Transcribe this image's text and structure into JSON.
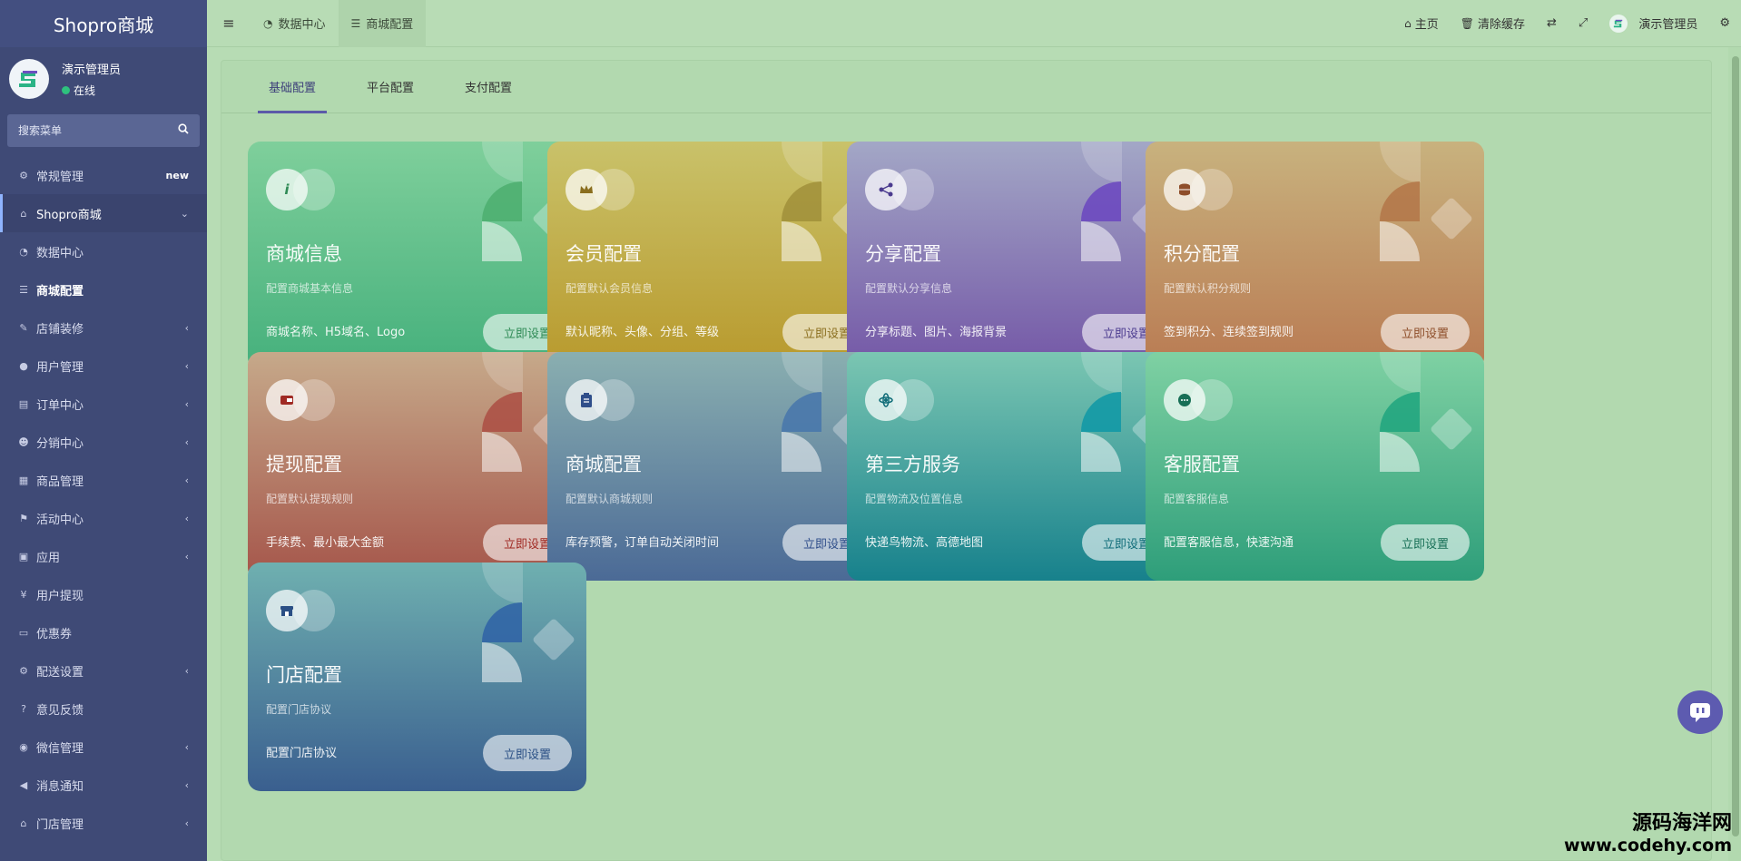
{
  "sidebar": {
    "brand": "Shopro商城",
    "user": {
      "name": "演示管理员",
      "status": "在线"
    },
    "search_placeholder": "搜索菜单",
    "items": [
      {
        "label": "常规管理",
        "icon": "cogs-icon",
        "badge": "new"
      },
      {
        "label": "Shopro商城",
        "icon": "home-icon",
        "arrow": "⌄"
      },
      {
        "label": "数据中心",
        "icon": "dashboard-icon"
      },
      {
        "label": "商城配置",
        "icon": "sliders-icon"
      },
      {
        "label": "店铺装修",
        "icon": "brush-icon",
        "arrow": "‹"
      },
      {
        "label": "用户管理",
        "icon": "user-icon",
        "arrow": "‹"
      },
      {
        "label": "订单中心",
        "icon": "file-icon",
        "arrow": "‹"
      },
      {
        "label": "分销中心",
        "icon": "users-icon",
        "arrow": "‹"
      },
      {
        "label": "商品管理",
        "icon": "list-icon",
        "arrow": "‹"
      },
      {
        "label": "活动中心",
        "icon": "flag-icon",
        "arrow": "‹"
      },
      {
        "label": "应用",
        "icon": "briefcase-icon",
        "arrow": "‹"
      },
      {
        "label": "用户提现",
        "icon": "yen-icon"
      },
      {
        "label": "优惠券",
        "icon": "ticket-icon"
      },
      {
        "label": "配送设置",
        "icon": "cogs-icon",
        "arrow": "‹"
      },
      {
        "label": "意见反馈",
        "icon": "question-icon"
      },
      {
        "label": "微信管理",
        "icon": "wechat-icon",
        "arrow": "‹"
      },
      {
        "label": "消息通知",
        "icon": "bullhorn-icon",
        "arrow": "‹"
      },
      {
        "label": "门店管理",
        "icon": "bank-icon",
        "arrow": "‹"
      }
    ]
  },
  "topbar": {
    "tabs": [
      {
        "label": "数据中心",
        "icon": "dashboard-icon"
      },
      {
        "label": "商城配置",
        "icon": "sliders-icon"
      }
    ],
    "home": "主页",
    "clear_cache": "清除缓存",
    "admin": "演示管理员"
  },
  "content_tabs": [
    "基础配置",
    "平台配置",
    "支付配置"
  ],
  "cards": [
    {
      "title": "商城信息",
      "desc": "配置商城基本信息",
      "feat": "商城名称、H5域名、Logo",
      "btn": "立即设置",
      "icon": "info-icon",
      "c1": "#7fcf9b",
      "c2": "#45b07c",
      "accent": "#4cae6e",
      "btncolor": "#2e8a55"
    },
    {
      "title": "会员配置",
      "desc": "配置默认会员信息",
      "feat": "默认昵称、头像、分组、等级",
      "btn": "立即设置",
      "icon": "crown-icon",
      "c1": "#c9c26a",
      "c2": "#b8992c",
      "accent": "#a08f3a",
      "btncolor": "#8a6e1e"
    },
    {
      "title": "分享配置",
      "desc": "配置默认分享信息",
      "feat": "分享标题、图片、海报背景",
      "btn": "立即设置",
      "icon": "share-icon",
      "c1": "#a3a7c6",
      "c2": "#7356a6",
      "accent": "#6a45c0",
      "btncolor": "#4a3a8e"
    },
    {
      "title": "积分配置",
      "desc": "配置默认积分规则",
      "feat": "签到积分、连续签到规则",
      "btn": "立即设置",
      "icon": "coins-icon",
      "c1": "#c8b27e",
      "c2": "#b97a52",
      "accent": "#b37648",
      "btncolor": "#8e4e2a"
    },
    {
      "title": "提现配置",
      "desc": "配置默认提现规则",
      "feat": "手续费、最小最大金额",
      "btn": "立即设置",
      "icon": "wallet-icon",
      "c1": "#c6a98a",
      "c2": "#a5554a",
      "accent": "#ac4d43",
      "btncolor": "#a02a24"
    },
    {
      "title": "商城配置",
      "desc": "配置默认商城规则",
      "feat": "库存预警，订单自动关闭时间",
      "btn": "立即设置",
      "icon": "clipboard-icon",
      "c1": "#8aafb0",
      "c2": "#4b6a96",
      "accent": "#4676ab",
      "btncolor": "#2f4e8a"
    },
    {
      "title": "第三方服务",
      "desc": "配置物流及位置信息",
      "feat": "快递鸟物流、高德地图",
      "btn": "立即设置",
      "icon": "atom-icon",
      "c1": "#7bc6b2",
      "c2": "#17818c",
      "accent": "#0e98a6",
      "btncolor": "#0f6c78"
    },
    {
      "title": "客服配置",
      "desc": "配置客服信息",
      "feat": "配置客服信息，快速沟通",
      "btn": "立即设置",
      "icon": "chat-icon",
      "c1": "#7fd1a3",
      "c2": "#2e9e7a",
      "accent": "#1ea57e",
      "btncolor": "#176f56"
    },
    {
      "title": "门店配置",
      "desc": "配置门店协议",
      "feat": "配置门店协议",
      "btn": "立即设置",
      "icon": "store-icon",
      "c1": "#6fb0b0",
      "c2": "#3a5f8f",
      "accent": "#2e62a6",
      "btncolor": "#2a4f85"
    }
  ],
  "watermark": {
    "line1": "源码海洋网",
    "line2": "www.codehy.com"
  }
}
